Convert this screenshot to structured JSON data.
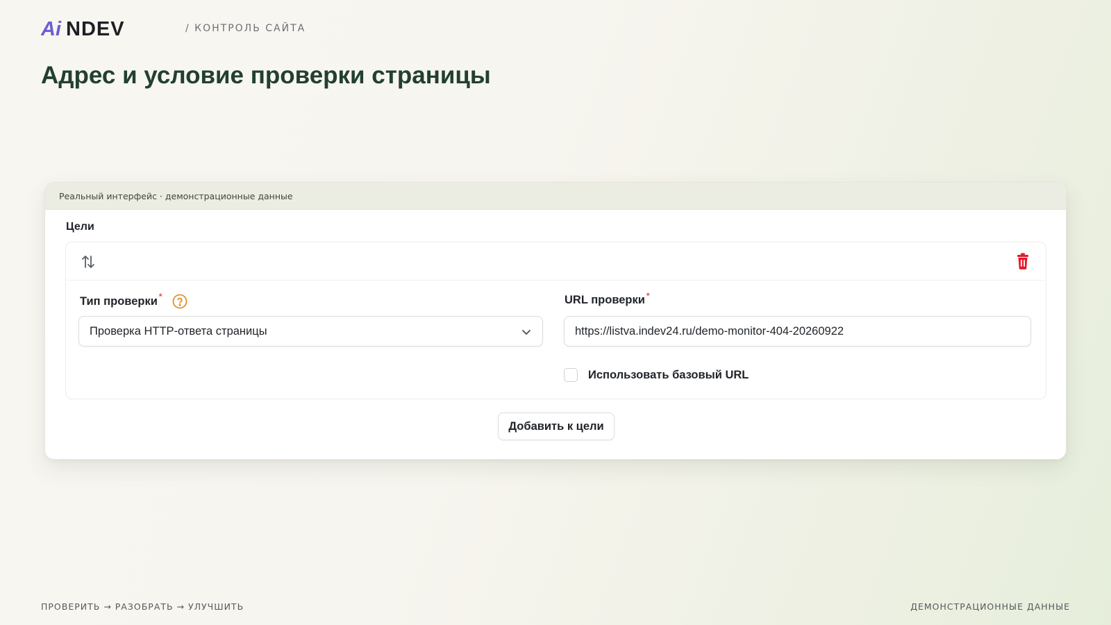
{
  "brand": {
    "logo_text_a": "Ai",
    "logo_text_b": "NDEV",
    "crumb": "/ КОНТРОЛЬ САЙТА",
    "colors": {
      "logo_accent": "#6b5fd3",
      "logo_dark": "#1e1f26",
      "title": "#22402f"
    }
  },
  "page_title": "Адрес и условие проверки страницы",
  "card": {
    "header_note": "Реальный интерфейс · демонстрационные данные",
    "section_label": "Цели",
    "goal": {
      "reorder_icon": "sort-arrows-icon",
      "delete_icon": "trash-icon",
      "check_type": {
        "label": "Тип проверки",
        "required_mark": "*",
        "help_icon": "question-circle-icon",
        "value": "Проверка HTTP-ответа страницы"
      },
      "check_url": {
        "label": "URL проверки",
        "required_mark": "*",
        "value": "https://listva.indev24.ru/demo-monitor-404-20260922"
      },
      "use_base_url": {
        "label": "Использовать базовый URL",
        "checked": false
      }
    },
    "add_button": "Добавить к цели"
  },
  "footer": {
    "left": "ПРОВЕРИТЬ → РАЗОБРАТЬ → УЛУЧШИТЬ",
    "right": "ДЕМОНСТРАЦИОННЫЕ ДАННЫЕ"
  },
  "colors": {
    "danger": "#e11d2e",
    "help": "#e0902a",
    "required": "#e5484d"
  }
}
